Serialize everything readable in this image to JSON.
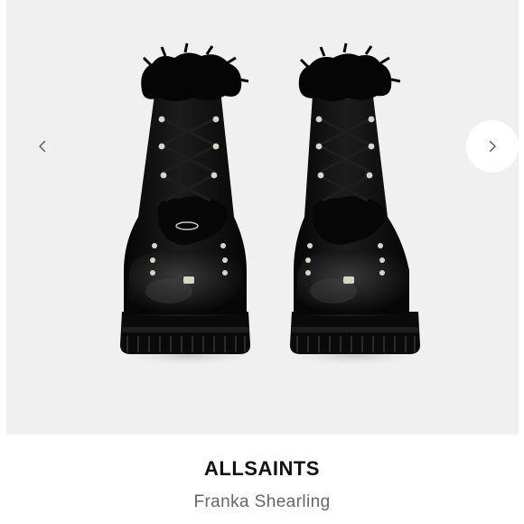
{
  "product": {
    "brand": "ALLSAINTS",
    "name": "Franka Shearling"
  },
  "gallery": {
    "image_alt": "black lace-up boots with black shearling trim",
    "prev_icon": "chevron-left-icon",
    "next_icon": "chevron-right-icon",
    "background_color": "#f1f0f0"
  },
  "colors": {
    "brand_text": "#111111",
    "name_text": "#666666",
    "boot": "#0c0c0c"
  }
}
